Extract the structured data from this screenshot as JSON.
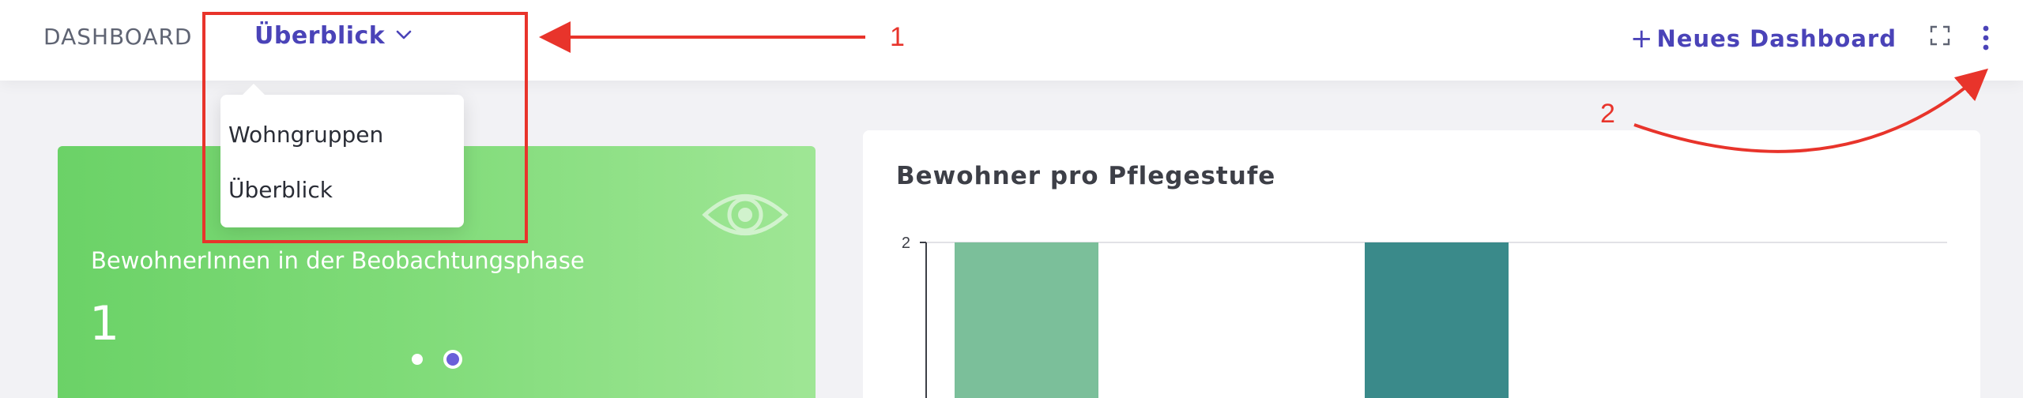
{
  "header": {
    "dashboard_label": "DASHBOARD",
    "current_dashboard": "Überblick",
    "new_dashboard_plus": "+",
    "new_dashboard_label": "Neues Dashboard",
    "fullscreen_icon": "fullscreen-icon",
    "more_icon": "kebab-menu-icon"
  },
  "dropdown": {
    "items": [
      "Wohngruppen",
      "Überblick"
    ]
  },
  "annotations": {
    "label_1": "1",
    "label_2": "2",
    "color": "#e8342b"
  },
  "kpi_card": {
    "label": "BewohnerInnen in der Beobachtungsphase",
    "value": "1",
    "icon": "eye-icon",
    "pager_dots": 2,
    "active_dot": 2
  },
  "chart_card": {
    "title": "Bewohner pro Pflegestufe"
  },
  "chart_data": {
    "type": "bar",
    "title": "Bewohner pro Pflegestufe",
    "categories": [
      "",
      ""
    ],
    "values": [
      2,
      2
    ],
    "colors": [
      "#7bbf9a",
      "#3a8a8a"
    ],
    "y_tick_labels": [
      "2"
    ],
    "ylim": [
      0,
      2
    ],
    "grid": true
  },
  "colors": {
    "accent": "#4a43b8",
    "card_green": "#6bd267",
    "page_bg": "#f2f2f5"
  }
}
